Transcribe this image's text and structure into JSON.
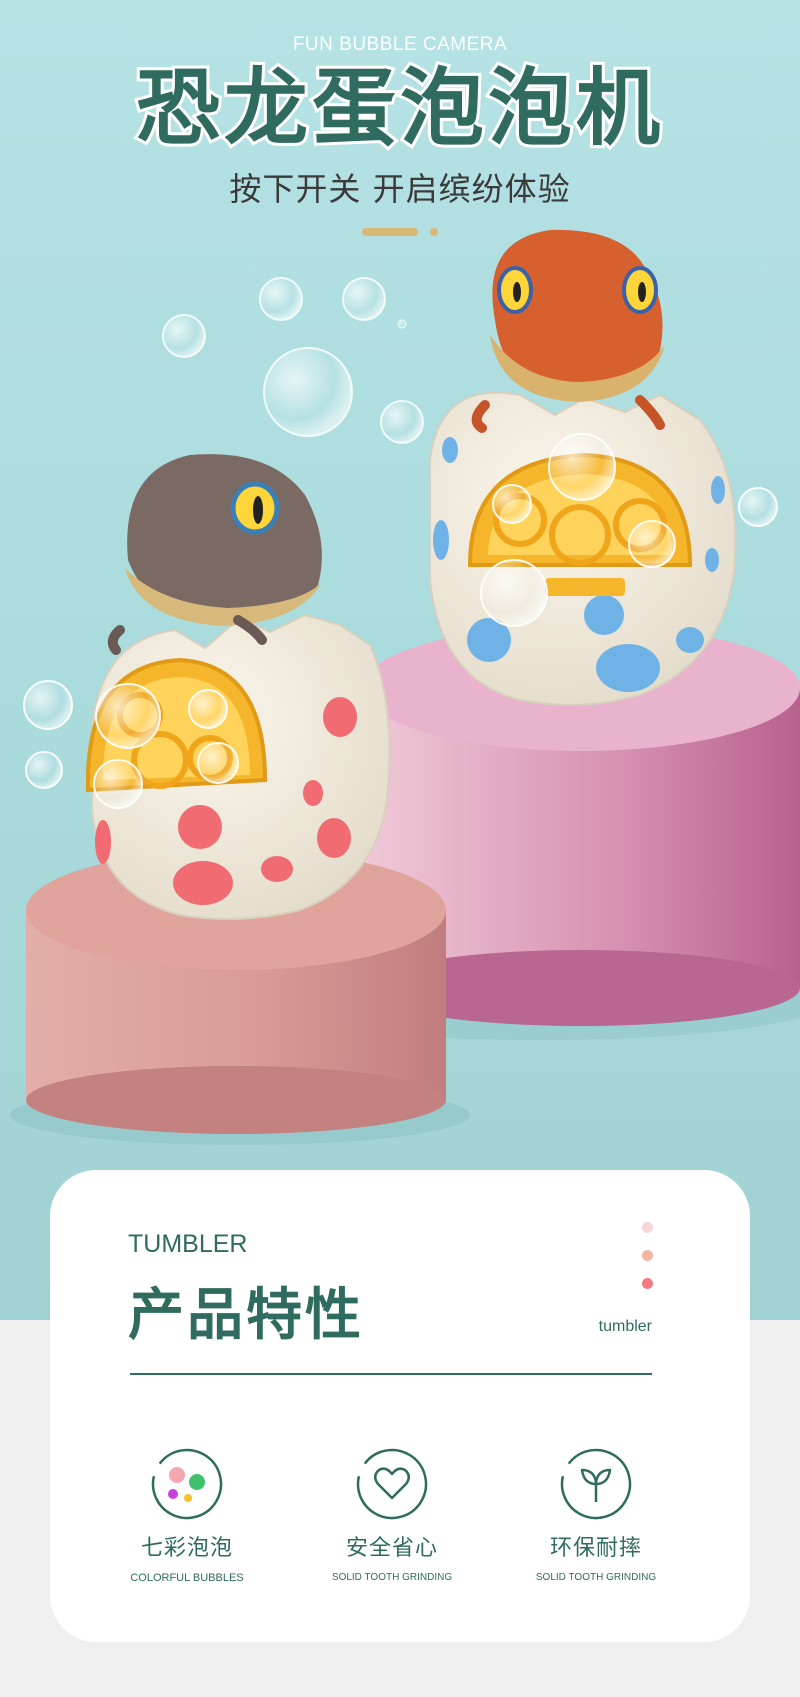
{
  "hero": {
    "subtitle_en": "FUN BUBBLE CAMERA",
    "title_cn": "恐龙蛋泡泡机",
    "tagline": "按下开关  开启缤纷体验"
  },
  "card": {
    "label_en": "TUMBLER",
    "title_cn": "产品特性",
    "small_en": "tumbler",
    "dot_colors": [
      "#f7d6d8",
      "#f4b49f",
      "#f37b81"
    ],
    "features": [
      {
        "icon": "colorful-bubbles-icon",
        "title": "七彩泡泡",
        "subtitle": "COLORFUL BUBBLES"
      },
      {
        "icon": "heart-icon",
        "title": "安全省心",
        "subtitle": "SOLID TOOTH GRINDING"
      },
      {
        "icon": "sprout-icon",
        "title": "环保耐摔",
        "subtitle": "SOLID TOOTH GRINDING"
      }
    ]
  },
  "colors": {
    "accent": "#2f6b5f",
    "background": "#abdcde",
    "gold": "#d9b774"
  }
}
